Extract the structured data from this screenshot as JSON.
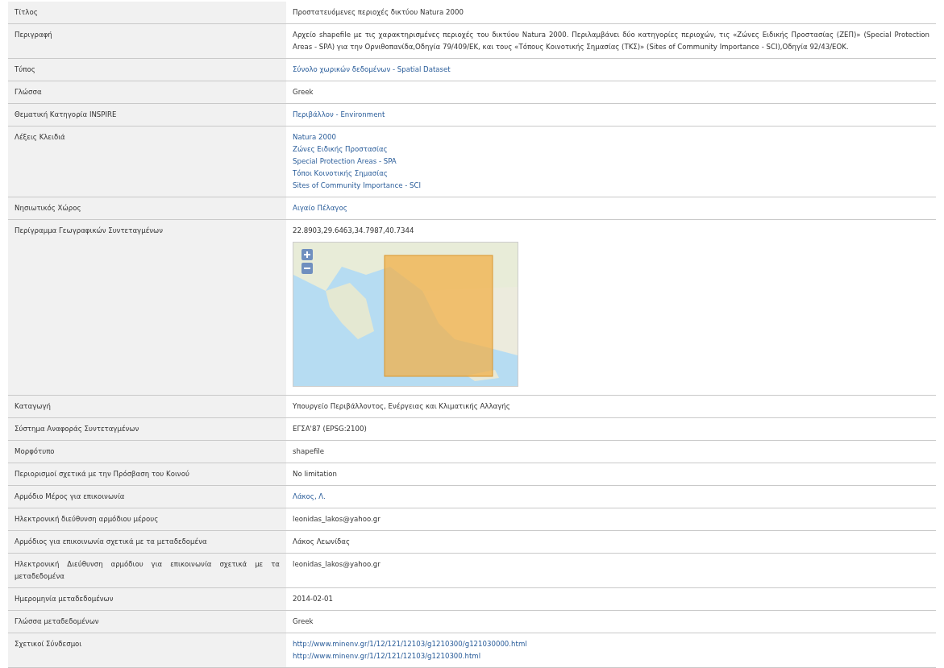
{
  "rows": [
    {
      "label": "Τίτλος",
      "kind": "text",
      "value": "Προστατευόμενες περιοχές δικτύου Natura 2000"
    },
    {
      "label": "Περιγραφή",
      "kind": "text",
      "value": "Αρχείο shapefile με τις χαρακτηρισμένες περιοχές του δικτύου Natura 2000. Περιλαμβάνει δύο κατηγορίες περιοχών, τις «Ζώνες Ειδικής Προστασίας (ΖΕΠ)» (Special Protection Areas - SPA) για την Ορνιθοπανίδα,Οδηγία 79/409/ΕΚ, και τους «Τόπους Κοινοτικής Σημασίας (ΤΚΣ)» (Sites of Community Importance - SCI),Οδηγία 92/43/ΕΟΚ."
    },
    {
      "label": "Τύπος",
      "kind": "links",
      "links": [
        "Σύνολο χωρικών δεδομένων - Spatial Dataset"
      ]
    },
    {
      "label": "Γλώσσα",
      "kind": "text",
      "value": "Greek"
    },
    {
      "label": "Θεματική Κατηγορία INSPIRE",
      "kind": "links",
      "links": [
        "Περιβάλλον - Environment"
      ]
    },
    {
      "label": "Λέξεις Κλειδιά",
      "kind": "links",
      "links": [
        "Natura 2000",
        "Ζώνες Ειδικής Προστασίας",
        "Special Protection Areas - SPA",
        "Τόποι Κοινοτικής Σημασίας",
        "Sites of Community Importance - SCI"
      ]
    },
    {
      "label": "Νησιωτικός Χώρος",
      "kind": "links",
      "links": [
        "Αιγαίο Πέλαγος"
      ]
    },
    {
      "label": "Περίγραμμα Γεωγραφικών Συντεταγμένων",
      "kind": "map",
      "value": "22.8903,29.6463,34.7987,40.7344"
    },
    {
      "label": "Καταγωγή",
      "kind": "text",
      "value": "Υπουργείο Περιβάλλοντος, Ενέργειας και Κλιματικής Αλλαγής"
    },
    {
      "label": "Σύστημα Αναφοράς Συντεταγμένων",
      "kind": "text",
      "value": "ΕΓΣΑ'87 (EPSG:2100)"
    },
    {
      "label": "Μορφότυπο",
      "kind": "text",
      "value": "shapefile"
    },
    {
      "label": "Περιορισμοί σχετικά με την Πρόσβαση του Κοινού",
      "kind": "text",
      "value": "No limitation"
    },
    {
      "label": "Αρμόδιο Μέρος για επικοινωνία",
      "kind": "links",
      "links": [
        "Λάκος, Λ."
      ]
    },
    {
      "label": "Ηλεκτρονική διεύθυνση αρμόδιου μέρους",
      "kind": "text",
      "value": "leonidas_lakos@yahoo.gr"
    },
    {
      "label": "Αρμόδιος για επικοινωνία σχετικά με τα μεταδεδομένα",
      "kind": "text",
      "value": "Λάκος Λεωνίδας"
    },
    {
      "label": "Ηλεκτρονική Διεύθυνση αρμόδιου για επικοινωνία σχετικά με τα μεταδεδομένα",
      "kind": "text",
      "value": "leonidas_lakos@yahoo.gr"
    },
    {
      "label": "Ημερομηνία μεταδεδομένων",
      "kind": "text",
      "value": "2014-02-01"
    },
    {
      "label": "Γλώσσα μεταδεδομένων",
      "kind": "text",
      "value": "Greek"
    },
    {
      "label": "Σχετικοί Σύνδεσμοι",
      "kind": "links",
      "links": [
        "http://www.minenv.gr/1/12/121/12103/g1210300/g121030000.html",
        "http://www.minenv.gr/1/12/121/12103/g1210300.html"
      ]
    }
  ]
}
